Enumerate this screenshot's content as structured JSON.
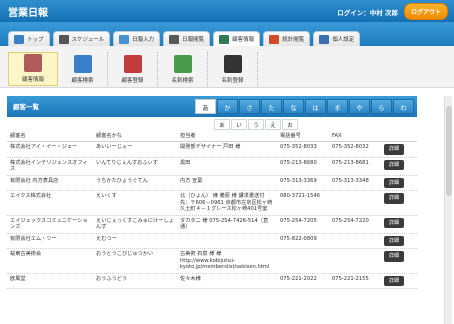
{
  "app": {
    "title": "営業日報",
    "login_label": "ログイン：中村 次郎",
    "logout_label": "ログアウト"
  },
  "tabs": [
    {
      "label": "トップ",
      "icon": "home-icon",
      "color": "#3b7fc4",
      "active": false
    },
    {
      "label": "スケジュール",
      "icon": "calendar-icon",
      "color": "#555555",
      "active": false
    },
    {
      "label": "日報入力",
      "icon": "pencil-icon",
      "color": "#4a8fd0",
      "active": false
    },
    {
      "label": "日報閲覧",
      "icon": "document-icon",
      "color": "#5a5a5a",
      "active": false
    },
    {
      "label": "顧客情報",
      "icon": "person-card-icon",
      "color": "#2f7b55",
      "active": true
    },
    {
      "label": "統計閲覧",
      "icon": "chart-icon",
      "color": "#d14b2c",
      "active": false
    },
    {
      "label": "個人設定",
      "icon": "user-gear-icon",
      "color": "#3c6fb0",
      "active": false
    }
  ],
  "subnav": [
    {
      "label": "顧客情報",
      "icon": "customer-card-icon",
      "color": "#b05a5a",
      "active": true
    },
    {
      "label": "顧客検索",
      "icon": "people-search-icon",
      "color": "#3a7fc8",
      "active": false
    },
    {
      "label": "顧客登録",
      "icon": "register-icon",
      "color": "#c23c3c",
      "active": false
    },
    {
      "label": "名刺検索",
      "icon": "card-search-icon",
      "color": "#4a9a4a",
      "active": false
    },
    {
      "label": "名刺登録",
      "icon": "card-register-icon",
      "color": "#333333",
      "active": false
    }
  ],
  "panel": {
    "title": "顧客一覧",
    "kana": [
      "あ",
      "か",
      "さ",
      "た",
      "な",
      "は",
      "ま",
      "や",
      "ら",
      "わ"
    ],
    "active_kana": "あ",
    "subkana": [
      "あ",
      "い",
      "う",
      "え",
      "お"
    ]
  },
  "table": {
    "headers": [
      "顧客名",
      "顧客名かな",
      "担当者",
      "電話番号",
      "FAX",
      ""
    ],
    "detail_label": "詳細",
    "rows": [
      {
        "name": "株式会社アイ・イー・ジェー",
        "kana": "あいいーじぇー",
        "contact": "開発部デザイナー 戸田 様",
        "tel": "075-352-8033",
        "fax": "075-352-8032"
      },
      {
        "name": "株式会社インテリジェンスオフィス",
        "kana": "いんてりじぇんすおふぃす",
        "contact": "黒田",
        "tel": "075-213-8680",
        "fax": "075-213-8681"
      },
      {
        "name": "有限会社 内方表具店",
        "kana": "うちかたひょうぐてん",
        "contact": "内方 宣葉",
        "tel": "075-313-3369",
        "fax": "075-313-3348"
      },
      {
        "name": "エイクス株式会社",
        "kana": "えいくす",
        "contact": "北（ひょん） 様 義原 様 課求書送付先：〒606－0961 京都市左京区松ヶ崎久土町４－１グレース松ヶ崎401号室",
        "tel": "080-3721-1546",
        "fax": ""
      },
      {
        "name": "エイジェックスコミュニケーションズ",
        "kana": "えいじぇっくすこみゅにけーしょんず",
        "contact": "タカタニ 様 075-254-7426-514（直通）",
        "tel": "075-254-7205",
        "fax": "075-254-7220"
      },
      {
        "name": "有限会社エム・ツー",
        "kana": "えむつー",
        "contact": "",
        "tel": "075-822-0809",
        "fax": ""
      },
      {
        "name": "桜東古美術会",
        "kana": "おうとうこびじゅつかい",
        "contact": "古美術 石泉 様 様 http://www.kobijutsu-kyoto.jp/memberslist/sekisen.html",
        "tel": "",
        "fax": ""
      },
      {
        "name": "欧風堂",
        "kana": "おうふうどう",
        "contact": "佐々木様",
        "tel": "075-221-2022",
        "fax": "075-221-2155"
      }
    ]
  }
}
